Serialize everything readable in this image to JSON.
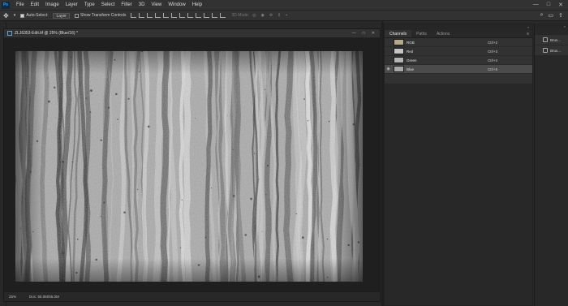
{
  "app": {
    "logo": "Ps"
  },
  "menu": [
    "File",
    "Edit",
    "Image",
    "Layer",
    "Type",
    "Select",
    "Filter",
    "3D",
    "View",
    "Window",
    "Help"
  ],
  "window_controls": [
    "—",
    "□",
    "✕"
  ],
  "options": {
    "auto_select_label": "Auto-Select:",
    "layer_select": "Layer",
    "show_transform_label": "Show Transform Controls",
    "mode_3d_label": "3D Mode:"
  },
  "document": {
    "tab_title": "ZLJ6353-Edit.tif @ 25% (Blue/16) *",
    "tab_controls": [
      "—",
      "□",
      "✕"
    ],
    "zoom": "25%",
    "doc_info": "Doc: 55.0M/55.0M"
  },
  "channels_panel": {
    "tabs": [
      "Channels",
      "Paths",
      "Actions"
    ],
    "channels": [
      {
        "name": "RGB",
        "shortcut": "Ctrl+2",
        "visible": false,
        "selected": false,
        "thumb_color": "#b7a98e"
      },
      {
        "name": "Red",
        "shortcut": "Ctrl+3",
        "visible": false,
        "selected": false,
        "thumb_color": "#c4c4c4"
      },
      {
        "name": "Green",
        "shortcut": "Ctrl+4",
        "visible": false,
        "selected": false,
        "thumb_color": "#b4b4b4"
      },
      {
        "name": "Blue",
        "shortcut": "Ctrl+5",
        "visible": true,
        "selected": true,
        "thumb_color": "#a8a8a8"
      }
    ]
  },
  "right_dock": {
    "items": [
      {
        "label": "Brus..."
      },
      {
        "label": "Brus..."
      }
    ]
  }
}
